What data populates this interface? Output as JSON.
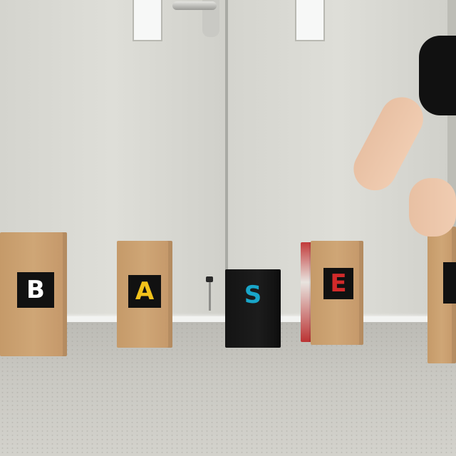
{
  "blocks": [
    {
      "letter": "B",
      "color": "#ffffff"
    },
    {
      "letter": "A",
      "color": "#f2c21b"
    },
    {
      "letter": "S",
      "color": "#19a6c9"
    },
    {
      "letter": "E",
      "color": "#d22a2a"
    },
    {
      "letter": "",
      "color": "#f2c21b"
    }
  ]
}
